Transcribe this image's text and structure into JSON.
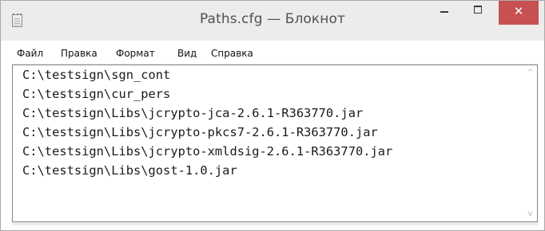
{
  "window": {
    "title": "Paths.cfg — Блокнот",
    "icon": "notepad-icon",
    "controls": {
      "minimize_icon": "minimize-icon",
      "maximize_icon": "maximize-icon",
      "close_icon": "close-icon",
      "close_glyph": "✕"
    },
    "colors": {
      "titlebar": "#ececec",
      "close_button": "#c75050",
      "title_text": "#505050"
    }
  },
  "menu": {
    "items": [
      {
        "label": "Файл"
      },
      {
        "label": "Правка"
      },
      {
        "label": "Формат"
      },
      {
        "label": "Вид"
      },
      {
        "label": "Справка"
      }
    ]
  },
  "editor": {
    "lines": [
      "C:\\testsign\\sgn_cont",
      "C:\\testsign\\cur_pers",
      "C:\\testsign\\Libs\\jcrypto-jca-2.6.1-R363770.jar",
      "C:\\testsign\\Libs\\jcrypto-pkcs7-2.6.1-R363770.jar",
      "C:\\testsign\\Libs\\jcrypto-xmldsig-2.6.1-R363770.jar",
      "C:\\testsign\\Libs\\gost-1.0.jar"
    ],
    "scrollbar": {
      "up_glyph": "^",
      "down_glyph": "v"
    }
  }
}
